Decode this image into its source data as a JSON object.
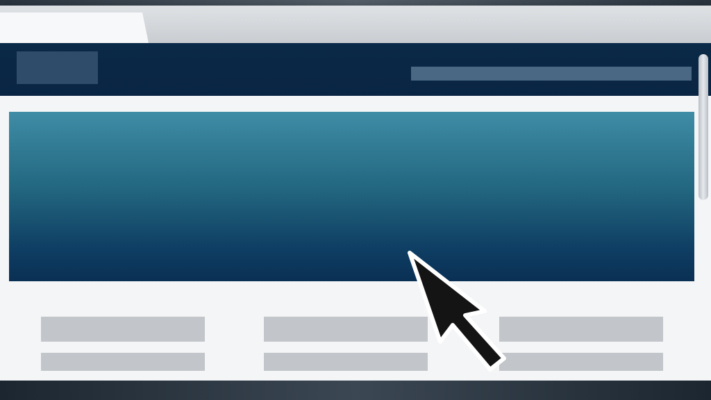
{
  "window": {
    "active_tab_label": "",
    "search_placeholder": ""
  },
  "icons": {
    "cursor": "arrow-pointer-icon"
  },
  "colors": {
    "header_bg": "#0b2a48",
    "hero_top": "#3f8ca6",
    "hero_bottom": "#0a2f54",
    "placeholder_block": "#c2c5c9",
    "page_bg": "#f4f5f6"
  }
}
